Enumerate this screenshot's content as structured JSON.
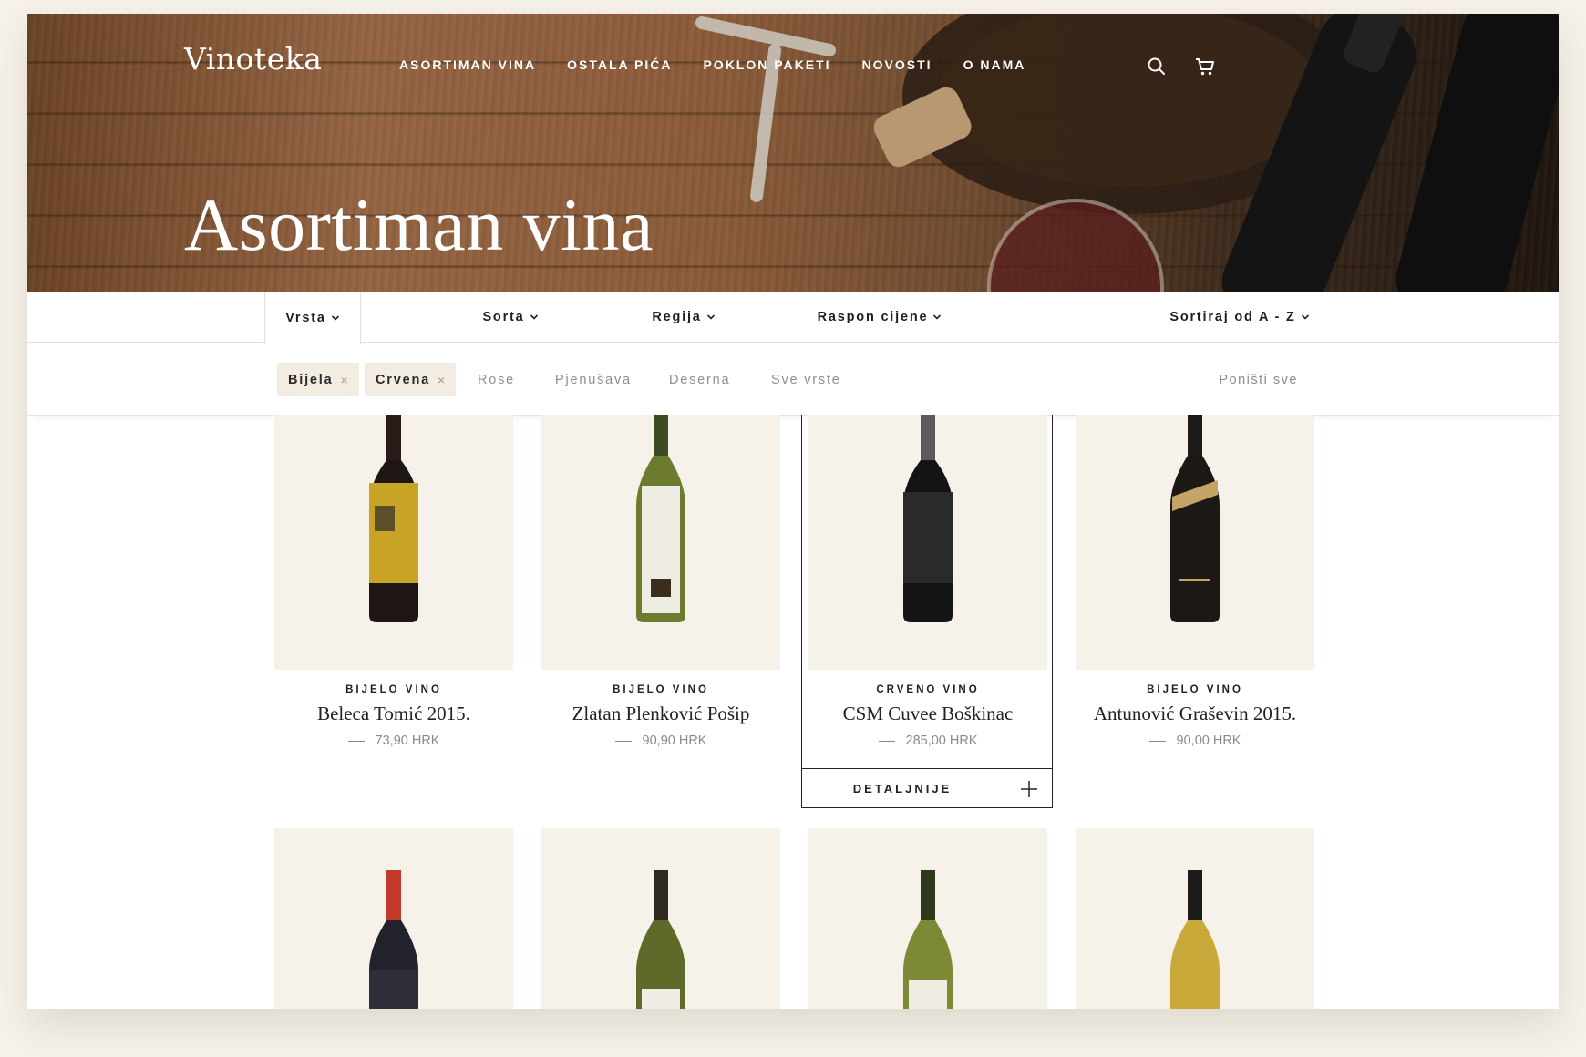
{
  "header": {
    "logo": "Vinoteka",
    "nav": [
      "ASORTIMAN VINA",
      "OSTALA PIĆA",
      "POKLON PAKETI",
      "NOVOSTI",
      "O NAMA"
    ],
    "icons": [
      "search-icon",
      "cart-icon"
    ],
    "title": "Asortiman vina"
  },
  "filters": {
    "items": [
      "Vrsta",
      "Sorta",
      "Regija",
      "Raspon cijene",
      "Sortiraj od A - Z"
    ],
    "active": "Vrsta"
  },
  "chips": {
    "selected": [
      "Bijela",
      "Crvena"
    ],
    "remove_symbol": "×",
    "options": [
      "Rose",
      "Pjenušava",
      "Deserna",
      "Sve vrste"
    ],
    "reset": "Poništi sve"
  },
  "products": [
    {
      "category": "BIJELO VINO",
      "name": "Beleca Tomić 2015.",
      "price": "73,90 HRK"
    },
    {
      "category": "BIJELO VINO",
      "name": "Zlatan Plenković Pošip",
      "price": "90,90 HRK"
    },
    {
      "category": "CRVENO VINO",
      "name": "CSM Cuvee Boškinac",
      "price": "285,00 HRK"
    },
    {
      "category": "BIJELO VINO",
      "name": "Antunović Graševin 2015.",
      "price": "90,00 HRK"
    }
  ],
  "product_actions": {
    "details": "DETALJNIJE"
  },
  "colors": {
    "page_bg": "#f6f2ea",
    "card_bg": "#f6f2ea",
    "chip_bg": "#f3ece0",
    "text_dark": "#222222",
    "text_muted": "#8a8a8a"
  }
}
